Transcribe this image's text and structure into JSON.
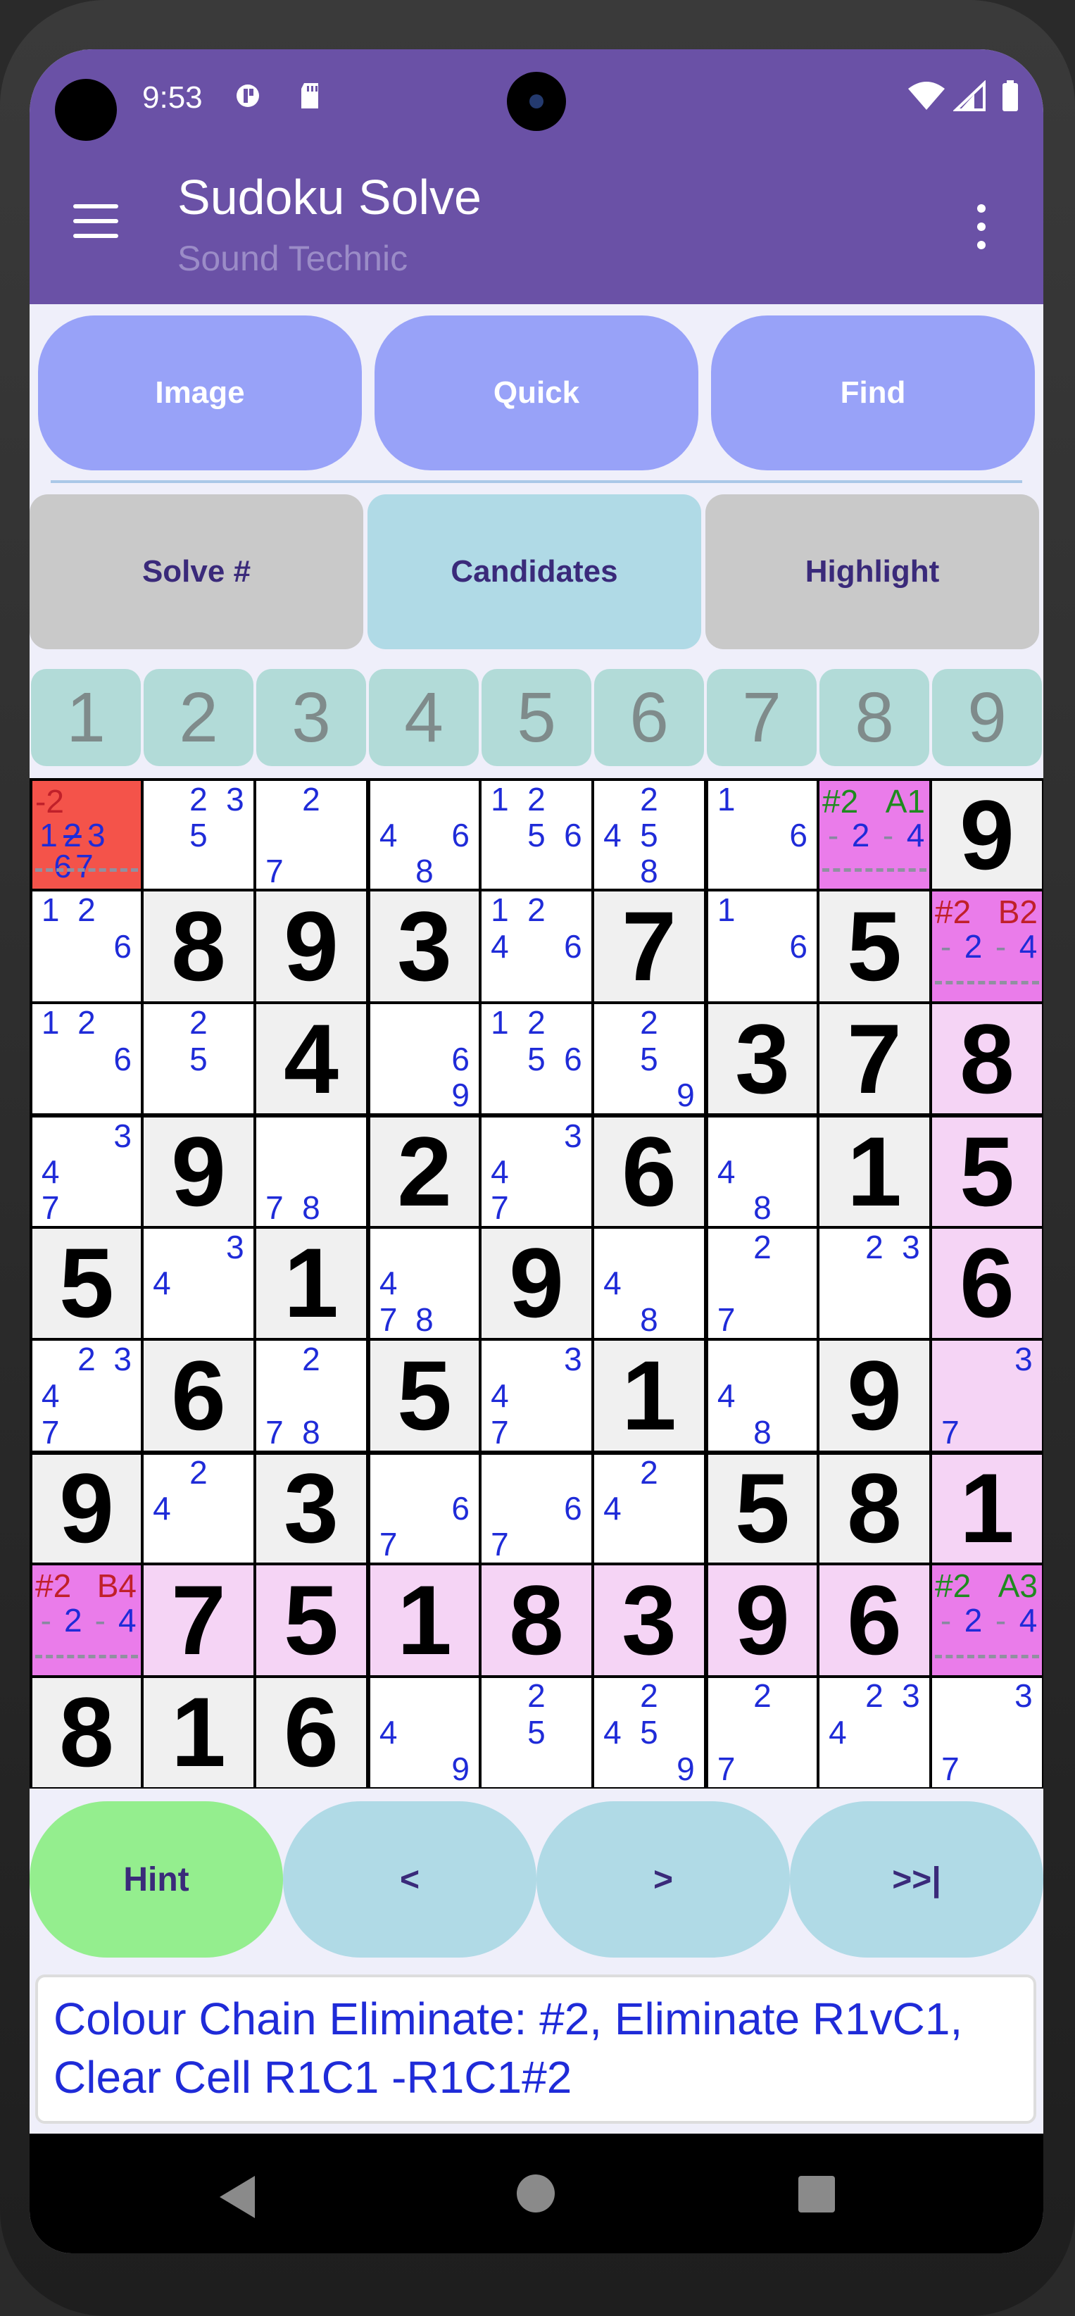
{
  "status": {
    "time": "9:53"
  },
  "appbar": {
    "title": "Sudoku Solve",
    "subtitle": "Sound Technic"
  },
  "buttons": {
    "top": [
      "Image",
      "Quick",
      "Find"
    ],
    "mode": [
      "Solve #",
      "Candidates",
      "Highlight"
    ],
    "bottom": [
      "Hint",
      "<",
      ">",
      ">>|"
    ]
  },
  "numbers": [
    "1",
    "2",
    "3",
    "4",
    "5",
    "6",
    "7",
    "8",
    "9"
  ],
  "colors": {
    "appbar": "#6a51a6",
    "highlight": "#f5d4f5",
    "chain": "#ea7cea",
    "eliminate": "#f4534a"
  },
  "grid": [
    [
      {
        "bg": "red",
        "label": "-2",
        "labelColor": "red",
        "cands": [
          null,
          null,
          null,
          null,
          null,
          null,
          null,
          null,
          null
        ],
        "special": "r1c1"
      },
      {
        "cands": [
          null,
          "2",
          "3",
          null,
          "5",
          null,
          null,
          null,
          null
        ]
      },
      {
        "cands": [
          null,
          "2",
          null,
          null,
          null,
          null,
          "7",
          null,
          null
        ]
      },
      {
        "cands": [
          null,
          null,
          null,
          "4",
          null,
          "6",
          null,
          "8",
          null
        ]
      },
      {
        "cands": [
          "1",
          "2",
          null,
          null,
          "5",
          "6",
          null,
          null,
          null
        ]
      },
      {
        "cands": [
          null,
          "2",
          null,
          "4",
          "5",
          null,
          null,
          "8",
          null
        ]
      },
      {
        "cands": [
          "1",
          null,
          null,
          null,
          null,
          "6",
          null,
          null,
          null
        ]
      },
      {
        "bg": "chain",
        "label": "#2",
        "label2": "A1",
        "labelColor": "green",
        "mid": [
          "-",
          "2",
          "-",
          "4"
        ],
        "dash": true
      },
      {
        "value": "9",
        "bg": "given"
      }
    ],
    [
      {
        "cands": [
          "1",
          "2",
          null,
          null,
          null,
          "6",
          null,
          null,
          null
        ]
      },
      {
        "value": "8",
        "bg": "given"
      },
      {
        "value": "9",
        "bg": "given"
      },
      {
        "value": "3",
        "bg": "given"
      },
      {
        "cands": [
          "1",
          "2",
          null,
          "4",
          null,
          "6",
          null,
          null,
          null
        ]
      },
      {
        "value": "7",
        "bg": "given"
      },
      {
        "cands": [
          "1",
          null,
          null,
          null,
          null,
          "6",
          null,
          null,
          null
        ]
      },
      {
        "value": "5",
        "bg": "given"
      },
      {
        "bg": "chain",
        "label": "#2",
        "label2": "B2",
        "labelColor": "red",
        "mid": [
          "-",
          "2",
          "-",
          "4"
        ],
        "dash": true
      }
    ],
    [
      {
        "cands": [
          "1",
          "2",
          null,
          null,
          null,
          "6",
          null,
          null,
          null
        ]
      },
      {
        "cands": [
          null,
          "2",
          null,
          null,
          "5",
          null,
          null,
          null,
          null
        ]
      },
      {
        "value": "4",
        "bg": "given"
      },
      {
        "cands": [
          null,
          null,
          null,
          null,
          null,
          "6",
          null,
          null,
          "9"
        ]
      },
      {
        "cands": [
          "1",
          "2",
          null,
          null,
          "5",
          "6",
          null,
          null,
          null
        ]
      },
      {
        "cands": [
          null,
          "2",
          null,
          null,
          "5",
          null,
          null,
          null,
          "9"
        ]
      },
      {
        "value": "3",
        "bg": "given"
      },
      {
        "value": "7",
        "bg": "given"
      },
      {
        "value": "8",
        "bg": "highlight"
      }
    ],
    [
      {
        "cands": [
          null,
          null,
          "3",
          "4",
          null,
          null,
          "7",
          null,
          null
        ]
      },
      {
        "value": "9",
        "bg": "given"
      },
      {
        "cands": [
          null,
          null,
          null,
          null,
          null,
          null,
          "7",
          "8",
          null
        ]
      },
      {
        "value": "2",
        "bg": "given"
      },
      {
        "cands": [
          null,
          null,
          "3",
          "4",
          null,
          null,
          "7",
          null,
          null
        ]
      },
      {
        "value": "6",
        "bg": "given"
      },
      {
        "cands": [
          null,
          null,
          null,
          "4",
          null,
          null,
          null,
          "8",
          null
        ]
      },
      {
        "value": "1",
        "bg": "given"
      },
      {
        "value": "5",
        "bg": "highlight"
      }
    ],
    [
      {
        "value": "5",
        "bg": "given"
      },
      {
        "cands": [
          null,
          null,
          "3",
          "4",
          null,
          null,
          null,
          null,
          null
        ]
      },
      {
        "value": "1",
        "bg": "given"
      },
      {
        "cands": [
          null,
          null,
          null,
          "4",
          null,
          null,
          "7",
          "8",
          null
        ]
      },
      {
        "value": "9",
        "bg": "given"
      },
      {
        "cands": [
          null,
          null,
          null,
          "4",
          null,
          null,
          null,
          "8",
          null
        ]
      },
      {
        "cands": [
          null,
          "2",
          null,
          null,
          null,
          null,
          "7",
          null,
          null
        ]
      },
      {
        "cands": [
          null,
          "2",
          "3",
          null,
          null,
          null,
          null,
          null,
          null
        ]
      },
      {
        "value": "6",
        "bg": "highlight"
      }
    ],
    [
      {
        "cands": [
          null,
          "2",
          "3",
          "4",
          null,
          null,
          "7",
          null,
          null
        ]
      },
      {
        "value": "6",
        "bg": "given"
      },
      {
        "cands": [
          null,
          "2",
          null,
          null,
          null,
          null,
          "7",
          "8",
          null
        ]
      },
      {
        "value": "5",
        "bg": "given"
      },
      {
        "cands": [
          null,
          null,
          "3",
          "4",
          null,
          null,
          "7",
          null,
          null
        ]
      },
      {
        "value": "1",
        "bg": "given"
      },
      {
        "cands": [
          null,
          null,
          null,
          "4",
          null,
          null,
          null,
          "8",
          null
        ]
      },
      {
        "value": "9",
        "bg": "given"
      },
      {
        "bg": "highlight",
        "cands": [
          null,
          null,
          "3",
          null,
          null,
          null,
          "7",
          null,
          null
        ]
      }
    ],
    [
      {
        "value": "9",
        "bg": "given"
      },
      {
        "cands": [
          null,
          "2",
          null,
          "4",
          null,
          null,
          null,
          null,
          null
        ]
      },
      {
        "value": "3",
        "bg": "given"
      },
      {
        "cands": [
          null,
          null,
          null,
          null,
          null,
          "6",
          "7",
          null,
          null
        ]
      },
      {
        "cands": [
          null,
          null,
          null,
          null,
          null,
          "6",
          "7",
          null,
          null
        ]
      },
      {
        "cands": [
          null,
          "2",
          null,
          "4",
          null,
          null,
          null,
          null,
          null
        ]
      },
      {
        "value": "5",
        "bg": "given"
      },
      {
        "value": "8",
        "bg": "given"
      },
      {
        "value": "1",
        "bg": "highlight"
      }
    ],
    [
      {
        "bg": "chain",
        "label": "#2",
        "label2": "B4",
        "labelColor": "red",
        "mid": [
          "-",
          "2",
          "-",
          "4"
        ],
        "dash": true
      },
      {
        "value": "7",
        "bg": "highlight"
      },
      {
        "value": "5",
        "bg": "highlight"
      },
      {
        "value": "1",
        "bg": "highlight"
      },
      {
        "value": "8",
        "bg": "highlight"
      },
      {
        "value": "3",
        "bg": "highlight"
      },
      {
        "value": "9",
        "bg": "highlight"
      },
      {
        "value": "6",
        "bg": "highlight"
      },
      {
        "bg": "chain",
        "label": "#2",
        "label2": "A3",
        "labelColor": "green",
        "mid": [
          "-",
          "2",
          "-",
          "4"
        ],
        "dash": true
      }
    ],
    [
      {
        "value": "8",
        "bg": "given"
      },
      {
        "value": "1",
        "bg": "given"
      },
      {
        "value": "6",
        "bg": "given"
      },
      {
        "cands": [
          null,
          null,
          null,
          "4",
          null,
          null,
          null,
          null,
          "9"
        ]
      },
      {
        "cands": [
          null,
          "2",
          null,
          null,
          "5",
          null,
          null,
          null,
          null
        ]
      },
      {
        "cands": [
          null,
          "2",
          null,
          "4",
          "5",
          null,
          null,
          null,
          "9"
        ]
      },
      {
        "cands": [
          null,
          "2",
          null,
          null,
          null,
          null,
          "7",
          null,
          null
        ]
      },
      {
        "cands": [
          null,
          "2",
          "3",
          "4",
          null,
          null,
          null,
          null,
          null
        ]
      },
      {
        "cands": [
          null,
          null,
          "3",
          null,
          null,
          null,
          "7",
          null,
          null
        ]
      }
    ]
  ],
  "r1c1": {
    "cands_line2": [
      "1",
      "2",
      "3"
    ],
    "cands_line3": [
      "6",
      "7"
    ]
  },
  "message": "Colour Chain Eliminate: #2, Eliminate R1vC1, Clear Cell R1C1 -R1C1#2"
}
